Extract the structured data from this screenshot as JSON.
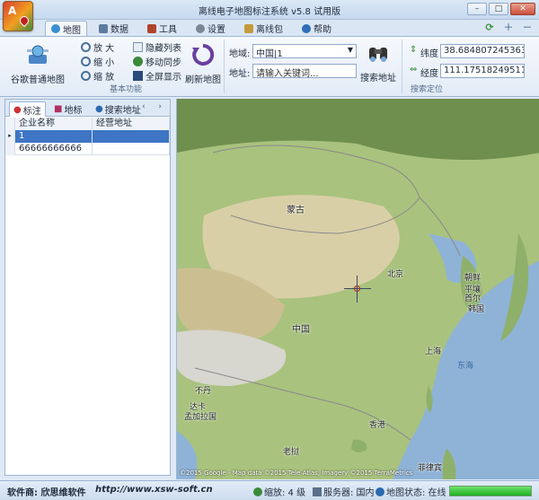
{
  "window": {
    "title": "离线电子地图标注系统 v5.8 试用版",
    "app_icon_glyph": "A",
    "controls": {
      "minimize": "–",
      "maximize": "□",
      "close": "✕"
    }
  },
  "ribbon_tabs": [
    {
      "label": "地图",
      "active": true,
      "icon": "globe-icon"
    },
    {
      "label": "数据",
      "active": false,
      "icon": "grid-icon"
    },
    {
      "label": "工具",
      "active": false,
      "icon": "toolbox-icon"
    },
    {
      "label": "设置",
      "active": false,
      "icon": "gear-icon"
    },
    {
      "label": "离线包",
      "active": false,
      "icon": "package-icon"
    },
    {
      "label": "帮助",
      "active": false,
      "icon": "help-icon"
    }
  ],
  "quick_tools": {
    "refresh": "⟳",
    "zoom_in": "＋",
    "zoom_out": "－"
  },
  "ribbon": {
    "basic_group": {
      "label": "基本功能",
      "map_type_button": "谷歌普通地图",
      "zoom_in": "放 大",
      "zoom_out": "缩 小",
      "zoom_pan": "缩 放",
      "hide_list": "隐藏列表",
      "move_sync": "移动同步",
      "fullscreen": "全屏显示",
      "refresh_map": "刷新地图"
    },
    "search_group": {
      "label": "搜索定位",
      "region_label": "地域:",
      "region_value": "中国|1",
      "address_label": "地址:",
      "address_placeholder": "请输入关键词...",
      "search_button": "搜索地址",
      "latitude_label": "纬度",
      "latitude_value": "38.6848072453636",
      "longitude_label": "经度",
      "longitude_value": "111.175182495117"
    }
  },
  "left_panel": {
    "tabs": [
      {
        "label": "标注",
        "active": true
      },
      {
        "label": "地标",
        "active": false
      },
      {
        "label": "搜索地址",
        "active": false
      }
    ],
    "nav": "‹ ›",
    "columns": [
      "企业名称",
      "经营地址"
    ],
    "rows": [
      {
        "marker": "▸",
        "name": "1",
        "address": "",
        "selected": true
      },
      {
        "marker": "",
        "name": "66666666666",
        "address": "",
        "selected": false
      }
    ]
  },
  "map": {
    "labels": {
      "mongolia": "蒙古",
      "china": "中国",
      "beijing": "北京",
      "north_korea": "朝鲜",
      "pyongyang": "平壤",
      "seoul": "首尔",
      "south_korea": "韩国",
      "shanghai": "上海",
      "east_sea": "东海",
      "bhutan": "不丹",
      "dhaka": "达卡",
      "bangladesh": "孟加拉国",
      "hong_kong": "香港",
      "laos": "老挝",
      "philippines": "菲律宾"
    },
    "copyright": "©2015 Google - Map data ©2015 Tele Atlas, Imagery ©2015 TerraMetrics",
    "colors": {
      "land": "#a9c27e",
      "sea": "#8fb3d6",
      "desert": "#d9cfa6"
    }
  },
  "statusbar": {
    "vendor": "软件商: 欣思维软件",
    "website": "http://www.xsw-soft.cn",
    "zoom": "缩放: 4 级",
    "server": "服务器: 国内",
    "map_status": "地图状态: 在线",
    "progress": 1.0
  }
}
